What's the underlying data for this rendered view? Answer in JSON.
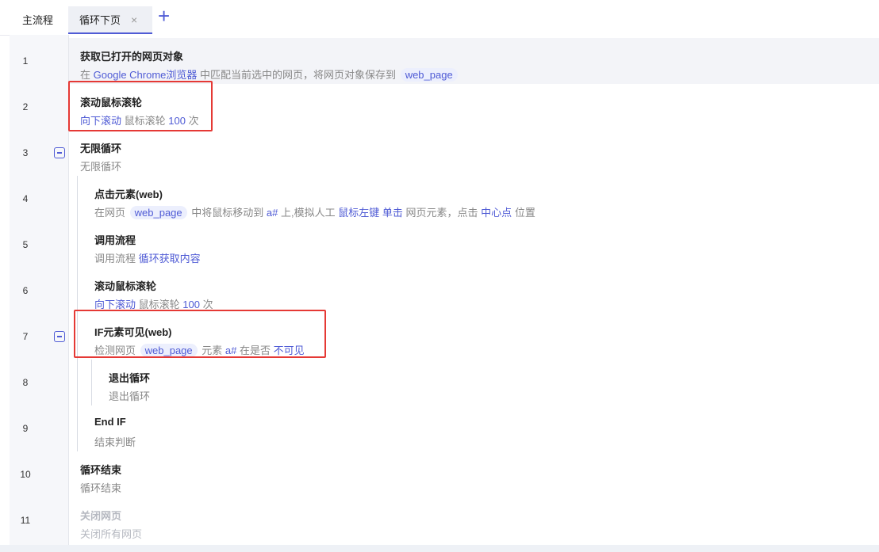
{
  "tabs": {
    "main_label": "主流程",
    "active_label": "循环下页",
    "close_icon": "×",
    "add_icon": "+"
  },
  "colors": {
    "accent": "#4f5bd5",
    "highlight_box": "#e53935",
    "muted_text": "#888888"
  },
  "steps": [
    {
      "line": "1",
      "title": "获取已打开的网页对象",
      "desc": {
        "t1": "在",
        "k1": "Google Chrome浏览器",
        "t2": "中匹配当前选中的网页，将网页对象保存到",
        "v1": "web_page"
      }
    },
    {
      "line": "2",
      "title": "滚动鼠标滚轮",
      "desc": {
        "k1": "向下滚动",
        "t1": "鼠标滚轮",
        "k2": "100",
        "t2": "次"
      }
    },
    {
      "line": "3",
      "title": "无限循环",
      "desc": {
        "t1": "无限循环"
      }
    },
    {
      "line": "4",
      "title": "点击元素(web)",
      "desc": {
        "t1": "在网页",
        "v1": "web_page",
        "t2": "中将鼠标移动到",
        "k1": "a#",
        "t3": "上,模拟人工",
        "k2": "鼠标左键",
        "k3": "单击",
        "t4": "网页元素，点击",
        "k4": "中心点",
        "t5": "位置"
      }
    },
    {
      "line": "5",
      "title": "调用流程",
      "desc": {
        "t1": "调用流程",
        "k1": "循环获取内容"
      }
    },
    {
      "line": "6",
      "title": "滚动鼠标滚轮",
      "desc": {
        "k1": "向下滚动",
        "t1": "鼠标滚轮",
        "k2": "100",
        "t2": "次"
      }
    },
    {
      "line": "7",
      "title": "IF元素可见(web)",
      "desc": {
        "t1": "检测网页",
        "v1": "web_page",
        "t2": "元素",
        "k1": "a#",
        "t3": "在是否",
        "k2": "不可见"
      }
    },
    {
      "line": "8",
      "title": "退出循环",
      "desc": {
        "t1": "退出循环"
      }
    },
    {
      "line": "9",
      "title": "End IF",
      "desc": {
        "t1": "结束判断"
      }
    },
    {
      "line": "10",
      "title": "循环结束",
      "desc": {
        "t1": "循环结束"
      }
    },
    {
      "line": "11",
      "title": "关闭网页",
      "desc": {
        "t1": "关闭所有网页"
      }
    }
  ]
}
